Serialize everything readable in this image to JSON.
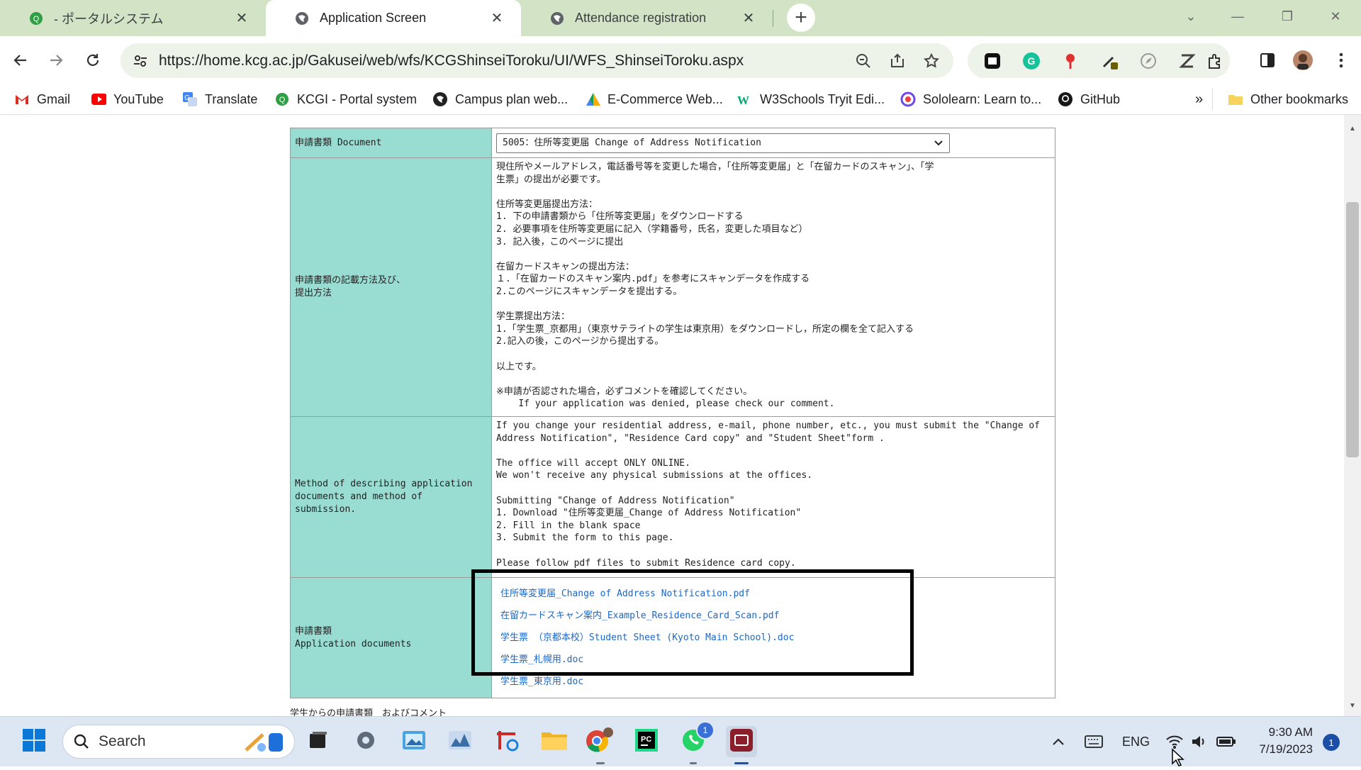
{
  "browser": {
    "tabs": [
      {
        "title": " - ポータルシステム",
        "icon": "kcg-portal-icon",
        "active": false
      },
      {
        "title": "Application Screen",
        "icon": "globe-icon",
        "active": true
      },
      {
        "title": "Attendance registration",
        "icon": "globe-icon",
        "active": false
      }
    ],
    "url": "https://home.kcg.ac.jp/Gakusei/web/wfs/KCGShinseiToroku/UI/WFS_ShinseiToroku.aspx",
    "bookmarks": [
      {
        "label": "Gmail",
        "icon": "gmail-icon"
      },
      {
        "label": "YouTube",
        "icon": "youtube-icon"
      },
      {
        "label": "Translate",
        "icon": "translate-icon"
      },
      {
        "label": "KCGI - Portal system",
        "icon": "kcg-portal-icon"
      },
      {
        "label": "Campus plan web...",
        "icon": "campus-plan-icon"
      },
      {
        "label": "E-Commerce Web...",
        "icon": "ecommerce-icon"
      },
      {
        "label": "W3Schools Tryit Edi...",
        "icon": "w3schools-icon"
      },
      {
        "label": "Sololearn: Learn to...",
        "icon": "sololearn-icon"
      },
      {
        "label": "GitHub",
        "icon": "github-icon"
      }
    ],
    "bookmarks_overflow": "»",
    "other_bookmarks": "Other bookmarks"
  },
  "form": {
    "document_label": "申請書類 Document",
    "document_selected": "5005：住所等変更届 Change of Address Notification",
    "method_jp_label": "申請書類の記載方法及び、\n提出方法",
    "method_jp_text": "現住所やメールアドレス，電話番号等を変更した場合，「住所等変更届」と「在留カードのスキャン」、「学\n生票」の提出が必要です。\n\n住所等変更届提出方法：\n1. 下の申請書類から「住所等変更届」をダウンロードする\n2. 必要事項を住所等変更届に記入（学籍番号，氏名，変更した項目など）\n3. 記入後，このページに提出\n\n在留カードスキャンの提出方法：\n１.「在留カードのスキャン案内.pdf」を参考にスキャンデータを作成する\n2.このページにスキャンデータを提出する。\n\n学生票提出方法：\n1.「学生票_京都用」（東京サテライトの学生は東京用）をダウンロードし，所定の欄を全て記入する\n2.記入の後，このページから提出する。\n\n以上です。\n\n※申請が否認された場合，必ずコメントを確認してください。\n    If your application was denied, please check our comment.",
    "method_en_label": "Method of describing application\ndocuments and method of\nsubmission.",
    "method_en_text": "If you change your residential address, e-mail, phone number, etc., you must submit the \"Change of\nAddress Notification\", \"Residence Card copy\" and \"Student Sheet\"form .\n\nThe office will accept ONLY ONLINE.\nWe won't receive any physical submissions at the offices.\n\nSubmitting \"Change of Address Notification\"\n1. Download \"住所等変更届_Change of Address Notification\"\n2. Fill in the blank space\n3. Submit the form to this page.\n\nPlease follow pdf files to submit Residence card copy.",
    "app_docs_label": "申請書類\nApplication documents",
    "app_docs": [
      "住所等変更届_Change of Address Notification.pdf",
      "在留カードスキャン案内_Example_Residence_Card_Scan.pdf",
      "学生票 （京都本校）Student Sheet (Kyoto Main School).doc",
      "学生票_札幌用.doc",
      "学生票_東京用.doc"
    ],
    "below_note": "学生からの申請書類　およびコメント"
  },
  "taskbar": {
    "search_label": "Search",
    "apps": [
      {
        "name": "start-button",
        "icon": "windows-icon"
      },
      {
        "name": "task-view",
        "icon": "task-view-icon"
      },
      {
        "name": "settings",
        "icon": "gear-icon"
      },
      {
        "name": "photos",
        "icon": "photos-icon"
      },
      {
        "name": "charts-app",
        "icon": "chart-app-icon"
      },
      {
        "name": "snipping-tool",
        "icon": "snipping-icon"
      },
      {
        "name": "file-explorer",
        "icon": "folder-icon"
      },
      {
        "name": "chrome",
        "icon": "chrome-icon"
      },
      {
        "name": "pycharm",
        "icon": "pycharm-icon"
      },
      {
        "name": "whatsapp",
        "icon": "whatsapp-icon"
      },
      {
        "name": "recorder",
        "icon": "recorder-icon"
      }
    ],
    "whatsapp_badge": "1",
    "lang": "ENG",
    "time": "9:30 AM",
    "date": "7/19/2023",
    "notification_count": "1"
  },
  "colors": {
    "tabstrip": "#d3e3c6",
    "label_cell": "#99ddd2",
    "link": "#1a67c9",
    "highlight_box": "#000000"
  }
}
